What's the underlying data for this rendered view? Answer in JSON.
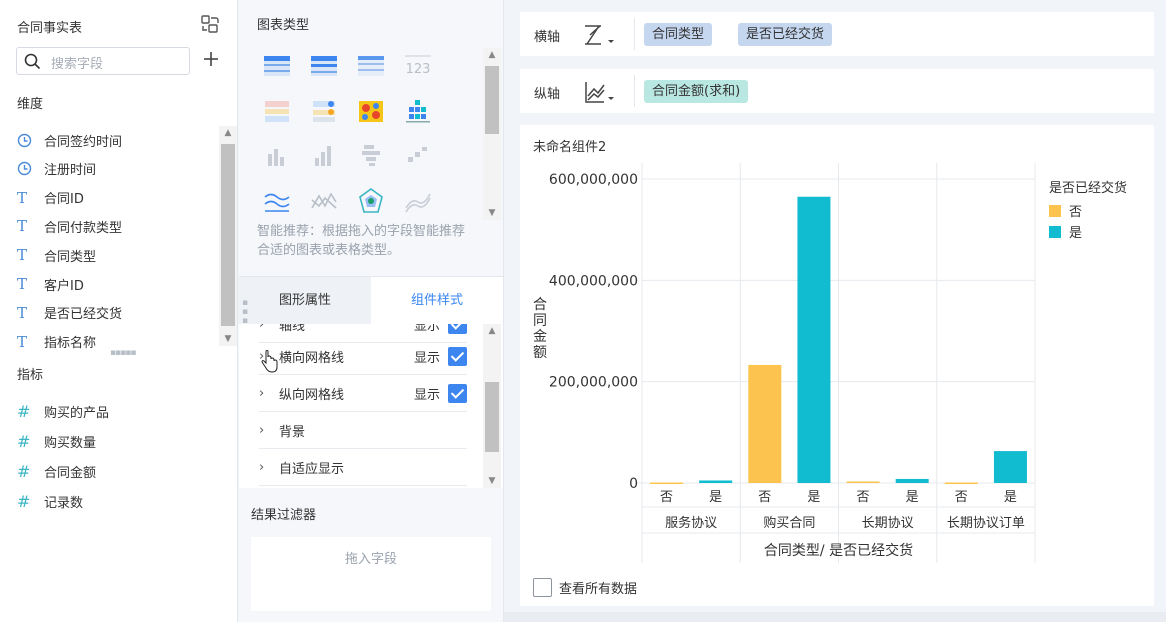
{
  "left_panel": {
    "table_name": "合同事实表",
    "search_placeholder": "搜索字段",
    "dimensions_title": "维度",
    "dimensions": [
      {
        "icon": "clock-icon",
        "label": "合同签约时间"
      },
      {
        "icon": "clock-icon",
        "label": "注册时间"
      },
      {
        "icon": "text-type-icon",
        "label": "合同ID"
      },
      {
        "icon": "text-type-icon",
        "label": "合同付款类型"
      },
      {
        "icon": "text-type-icon",
        "label": "合同类型"
      },
      {
        "icon": "text-type-icon",
        "label": "客户ID"
      },
      {
        "icon": "text-type-icon",
        "label": "是否已经交货"
      },
      {
        "icon": "text-type-icon",
        "label": "指标名称"
      }
    ],
    "measures_title": "指标",
    "measures": [
      {
        "icon": "hash-icon",
        "label": "购买的产品"
      },
      {
        "icon": "hash-icon",
        "label": "购买数量"
      },
      {
        "icon": "hash-icon",
        "label": "合同金额"
      },
      {
        "icon": "hash-icon",
        "label": "记录数"
      }
    ]
  },
  "middle_panel": {
    "chart_types_title": "图表类型",
    "recommend_text": "智能推荐：根据拖入的字段智能推荐合适的图表或表格类型。",
    "tabs": {
      "shape_props": "图形属性",
      "component_style": "组件样式"
    },
    "style_rows": [
      {
        "label": "轴线",
        "show": "显示"
      },
      {
        "label": "横向网格线",
        "show": "显示"
      },
      {
        "label": "纵向网格线",
        "show": "显示"
      },
      {
        "label": "背景",
        "show": ""
      },
      {
        "label": "自适应显示",
        "show": ""
      }
    ],
    "filter_title": "结果过滤器",
    "drop_text": "拖入字段"
  },
  "axes": {
    "x_label": "横轴",
    "x_fields": [
      "合同类型",
      "是否已经交货"
    ],
    "y_label": "纵轴",
    "y_fields": [
      "合同金额(求和)"
    ]
  },
  "chart_card": {
    "title": "未命名组件2",
    "view_all": "查看所有数据"
  },
  "colors": {
    "no": "#fcc44e",
    "yes": "#12bcd0",
    "accent": "#3685f2"
  },
  "chart_data": {
    "type": "bar",
    "groups": [
      "服务协议",
      "购买合同",
      "长期协议",
      "长期协议订单"
    ],
    "categories": [
      "否",
      "是"
    ],
    "series": [
      {
        "name": "否",
        "values": [
          1000000,
          233000000,
          3000000,
          1000000
        ]
      },
      {
        "name": "是",
        "values": [
          5000000,
          565000000,
          8000000,
          63000000
        ]
      }
    ],
    "ylim": [
      0,
      600000000
    ],
    "yticks": [
      "600,000,000",
      "400,000,000",
      "200,000,000",
      "0"
    ],
    "ytick_values": [
      600000000,
      400000000,
      200000000,
      0
    ],
    "xlabel": "合同类型/ 是否已经交货",
    "ylabel": "合同金额",
    "legend_title": "是否已经交货",
    "legend_position": "top-right",
    "grid": true
  }
}
